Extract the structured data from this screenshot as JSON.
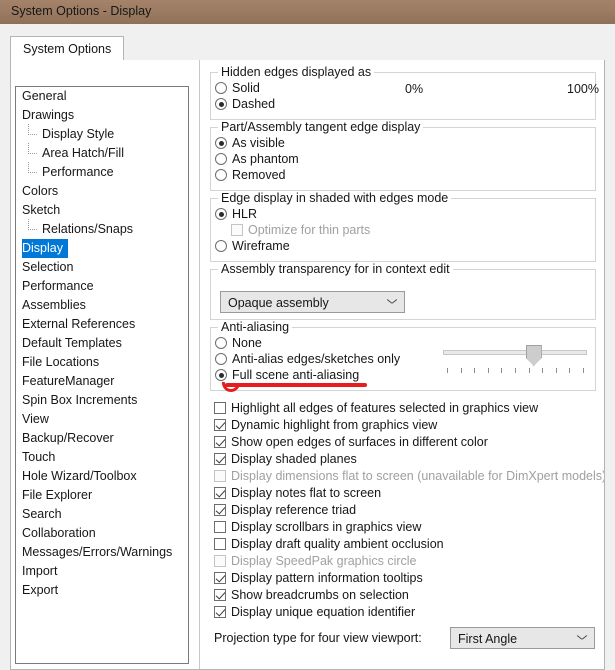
{
  "window": {
    "title": "System Options - Display"
  },
  "tabs": [
    {
      "label": "System Options",
      "active": true
    }
  ],
  "sidebar": {
    "items": [
      {
        "label": "General",
        "indent": 0,
        "selected": false
      },
      {
        "label": "Drawings",
        "indent": 0,
        "selected": false
      },
      {
        "label": "Display Style",
        "indent": 1,
        "selected": false
      },
      {
        "label": "Area Hatch/Fill",
        "indent": 1,
        "selected": false
      },
      {
        "label": "Performance",
        "indent": 1,
        "selected": false,
        "last": true
      },
      {
        "label": "Colors",
        "indent": 0,
        "selected": false
      },
      {
        "label": "Sketch",
        "indent": 0,
        "selected": false
      },
      {
        "label": "Relations/Snaps",
        "indent": 1,
        "selected": false,
        "last": true
      },
      {
        "label": "Display",
        "indent": 0,
        "selected": true
      },
      {
        "label": "Selection",
        "indent": 0,
        "selected": false
      },
      {
        "label": "Performance",
        "indent": 0,
        "selected": false
      },
      {
        "label": "Assemblies",
        "indent": 0,
        "selected": false
      },
      {
        "label": "External References",
        "indent": 0,
        "selected": false
      },
      {
        "label": "Default Templates",
        "indent": 0,
        "selected": false
      },
      {
        "label": "File Locations",
        "indent": 0,
        "selected": false
      },
      {
        "label": "FeatureManager",
        "indent": 0,
        "selected": false
      },
      {
        "label": "Spin Box Increments",
        "indent": 0,
        "selected": false
      },
      {
        "label": "View",
        "indent": 0,
        "selected": false
      },
      {
        "label": "Backup/Recover",
        "indent": 0,
        "selected": false
      },
      {
        "label": "Touch",
        "indent": 0,
        "selected": false
      },
      {
        "label": "Hole Wizard/Toolbox",
        "indent": 0,
        "selected": false
      },
      {
        "label": "File Explorer",
        "indent": 0,
        "selected": false
      },
      {
        "label": "Search",
        "indent": 0,
        "selected": false
      },
      {
        "label": "Collaboration",
        "indent": 0,
        "selected": false
      },
      {
        "label": "Messages/Errors/Warnings",
        "indent": 0,
        "selected": false
      },
      {
        "label": "Import",
        "indent": 0,
        "selected": false
      },
      {
        "label": "Export",
        "indent": 0,
        "selected": false
      }
    ]
  },
  "groups": {
    "hidden_edges": {
      "title": "Hidden edges displayed as",
      "options": [
        {
          "label": "Solid",
          "checked": false
        },
        {
          "label": "Dashed",
          "checked": true
        }
      ]
    },
    "tangent_edge": {
      "title": "Part/Assembly tangent edge display",
      "options": [
        {
          "label": "As visible",
          "checked": true
        },
        {
          "label": "As phantom",
          "checked": false
        },
        {
          "label": "Removed",
          "checked": false
        }
      ]
    },
    "edge_display": {
      "title": "Edge display in shaded with edges mode",
      "options": [
        {
          "label": "HLR",
          "checked": true
        },
        {
          "label": "Wireframe",
          "checked": false
        }
      ],
      "sub_checkbox": {
        "label": "Optimize for thin parts",
        "checked": false,
        "disabled": true
      }
    },
    "transparency": {
      "title": "Assembly transparency for in context edit",
      "combo_value": "Opaque assembly",
      "slider": {
        "min_label": "0%",
        "max_label": "100%",
        "value": 62,
        "tick_count": 11
      }
    },
    "anti_aliasing": {
      "title": "Anti-aliasing",
      "options": [
        {
          "label": "None",
          "checked": false
        },
        {
          "label": "Anti-alias edges/sketches only",
          "checked": false
        },
        {
          "label": "Full scene anti-aliasing",
          "checked": true
        }
      ],
      "annotation_color": "#e71c1c"
    }
  },
  "checkbox_list": [
    {
      "label": "Highlight all edges of features selected in graphics view",
      "checked": false,
      "disabled": false
    },
    {
      "label": "Dynamic highlight from graphics view",
      "checked": true,
      "disabled": false
    },
    {
      "label": "Show open edges of surfaces in different color",
      "checked": true,
      "disabled": false
    },
    {
      "label": "Display shaded planes",
      "checked": true,
      "disabled": false
    },
    {
      "label": "Display dimensions flat to screen (unavailable for DimXpert models)",
      "checked": false,
      "disabled": true
    },
    {
      "label": "Display notes flat to screen",
      "checked": true,
      "disabled": false
    },
    {
      "label": "Display reference triad",
      "checked": true,
      "disabled": false
    },
    {
      "label": "Display scrollbars in graphics view",
      "checked": false,
      "disabled": false
    },
    {
      "label": "Display draft quality ambient occlusion",
      "checked": false,
      "disabled": false
    },
    {
      "label": "Display SpeedPak graphics circle",
      "checked": false,
      "disabled": true
    },
    {
      "label": "Display pattern information tooltips",
      "checked": true,
      "disabled": false
    },
    {
      "label": "Show breadcrumbs on selection",
      "checked": true,
      "disabled": false
    },
    {
      "label": "Display unique equation identifier",
      "checked": true,
      "disabled": false
    }
  ],
  "footer": {
    "projection_label": "Projection type for four view viewport:",
    "projection_value": "First Angle"
  },
  "colors": {
    "titlebar": "#9a7a61",
    "selection": "#0078d7",
    "annotation": "#e71c1c",
    "dialog_bg": "#f0f0f0"
  }
}
